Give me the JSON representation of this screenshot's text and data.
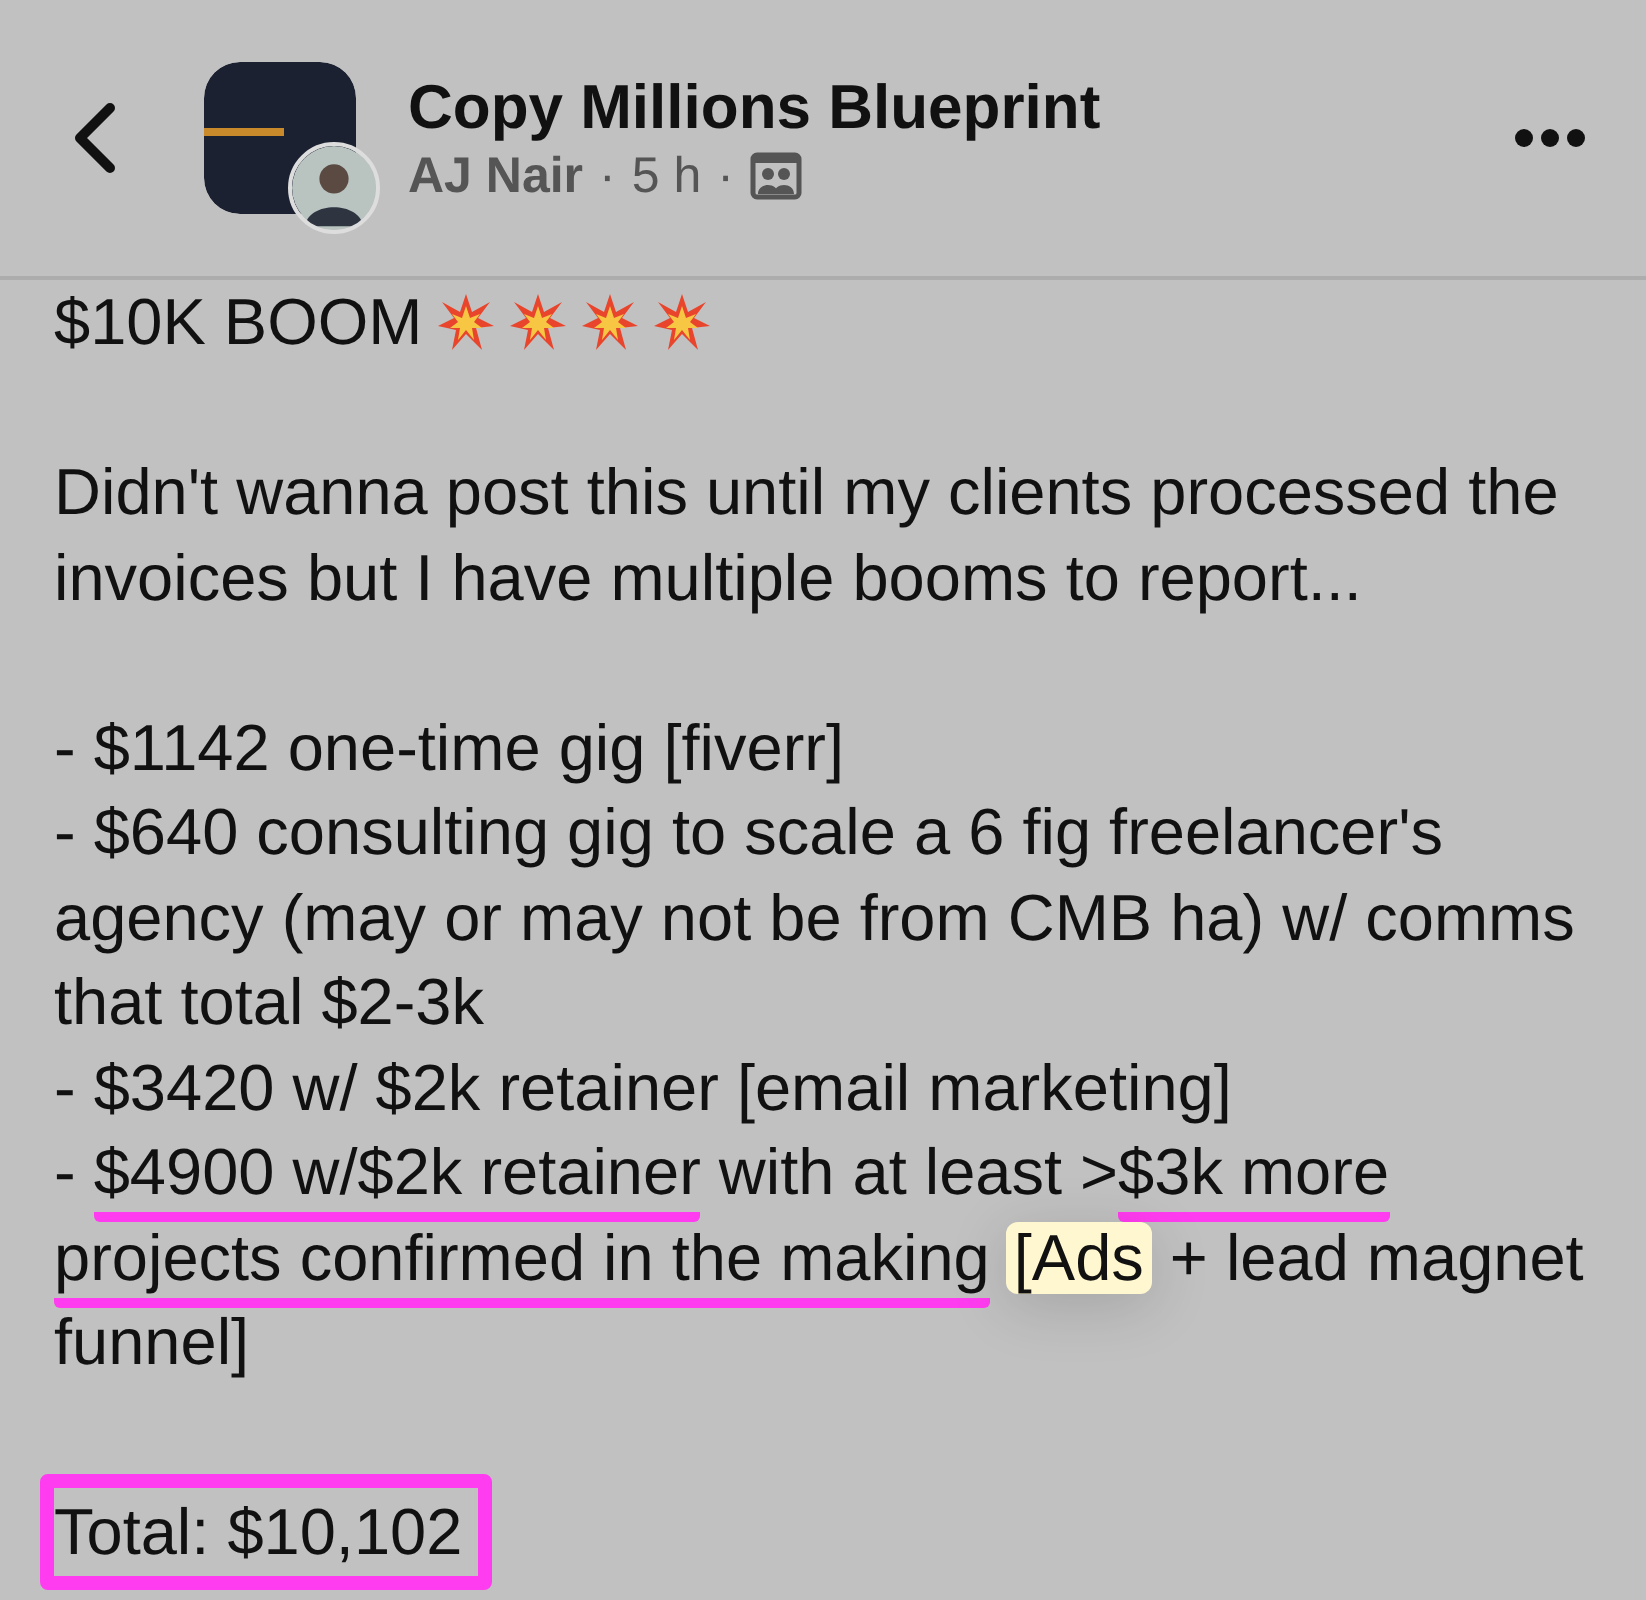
{
  "header": {
    "group_name": "Copy Millions Blueprint",
    "author": "AJ Nair",
    "separator_1": "·",
    "time": "5 h",
    "separator_2": "·"
  },
  "post": {
    "title": "$10K BOOM",
    "title_icons": [
      {
        "kind": "collision"
      },
      {
        "kind": "collision"
      },
      {
        "kind": "collision"
      },
      {
        "kind": "collision"
      }
    ],
    "lines": [
      {
        "kind": "blank"
      },
      {
        "kind": "text",
        "segments": [
          {
            "text": "Didn't wanna post this until my clients processed the",
            "kind": "plain"
          }
        ]
      },
      {
        "kind": "text",
        "segments": [
          {
            "text": "invoices but I have multiple booms to report...",
            "kind": "plain"
          }
        ]
      },
      {
        "kind": "blank"
      },
      {
        "kind": "text",
        "segments": [
          {
            "text": "- $1142 one-time gig [fiverr]",
            "kind": "plain"
          }
        ]
      },
      {
        "kind": "text",
        "segments": [
          {
            "text": "- $640 consulting gig to scale a 6 fig freelancer's",
            "kind": "plain"
          }
        ]
      },
      {
        "kind": "text",
        "segments": [
          {
            "text": "agency (may or may not be from CMB ha) w/ comms",
            "kind": "plain"
          }
        ]
      },
      {
        "kind": "text",
        "segments": [
          {
            "text": "that total $2-3k",
            "kind": "plain"
          }
        ]
      },
      {
        "kind": "text",
        "segments": [
          {
            "text": "- $3420 w/ $2k retainer [email marketing]",
            "kind": "plain"
          }
        ]
      },
      {
        "kind": "text",
        "segments": [
          {
            "text": "- ",
            "kind": "plain"
          },
          {
            "text": "$4900 w/$2k retainer",
            "kind": "underlined"
          },
          {
            "text": " with at least >",
            "kind": "plain"
          },
          {
            "text": "$3k more",
            "kind": "underlined"
          }
        ]
      },
      {
        "kind": "text",
        "segments": [
          {
            "text": "projects confirmed in the making",
            "kind": "underlined"
          },
          {
            "text": "[Ads",
            "kind": "highlighted"
          },
          {
            "text": " + lead magnet",
            "kind": "plain"
          }
        ]
      },
      {
        "kind": "text",
        "segments": [
          {
            "text": "funnel]",
            "kind": "plain"
          }
        ]
      },
      {
        "kind": "blank"
      },
      {
        "kind": "text",
        "segments": [
          {
            "text": "Total: $10,102",
            "kind": "boxed"
          }
        ]
      }
    ]
  }
}
